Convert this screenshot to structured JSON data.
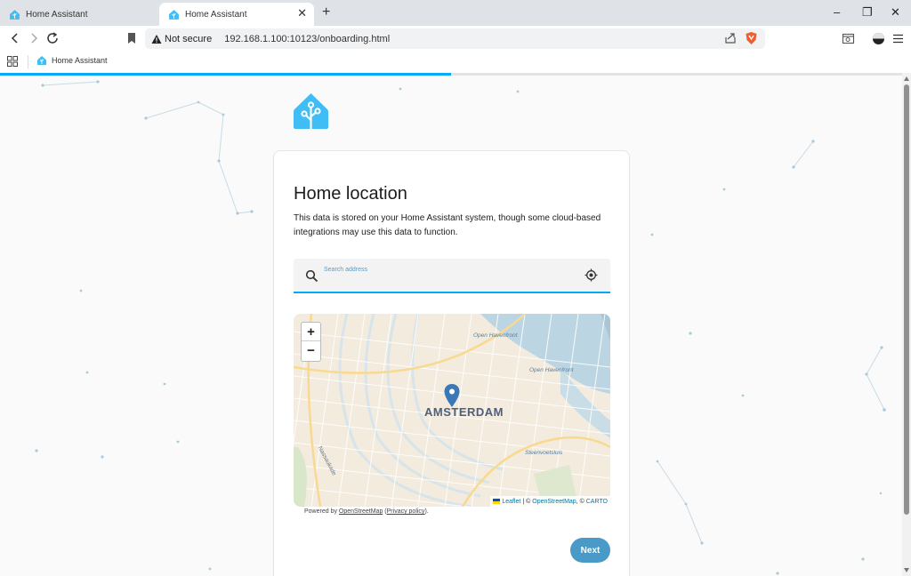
{
  "browser": {
    "tabs": [
      {
        "title": "Home Assistant",
        "active": false
      },
      {
        "title": "Home Assistant",
        "active": true
      }
    ],
    "new_tab_label": "+",
    "window_controls": {
      "minimize": "–",
      "maximize": "❐",
      "close": "✕"
    },
    "tab_close": "✕",
    "address": {
      "security_label": "Not secure",
      "url": "192.168.1.100:10123/onboarding.html"
    },
    "bookmarks": [
      {
        "label": "Home Assistant",
        "icon": "home-assistant-icon"
      }
    ]
  },
  "onboarding": {
    "progress_fraction": 0.5,
    "title": "Home location",
    "description": "This data is stored on your Home Assistant system, though some cloud-based integrations may use this data to function.",
    "search": {
      "placeholder": "Search address",
      "value": ""
    },
    "map": {
      "city_label": "AMSTERDAM",
      "labels": [
        "Open Havenfront",
        "Open Havenfront",
        "Steenvoetsluis",
        "Nassaukade"
      ],
      "zoom_in": "+",
      "zoom_out": "−",
      "attribution": {
        "leaflet": "Leaflet",
        "separator": "| ©",
        "osm": "OpenStreetMap",
        "carto_prefix": ", ©",
        "carto": "CARTO"
      }
    },
    "powered": {
      "prefix": "Powered by",
      "osm": "OpenStreetMap",
      "open_paren": "(",
      "privacy": "Privacy policy",
      "close_paren": ")."
    },
    "next_label": "Next"
  },
  "colors": {
    "accent": "#03a9f4",
    "button": "#4a9ac7",
    "logo": "#41bdf5"
  }
}
